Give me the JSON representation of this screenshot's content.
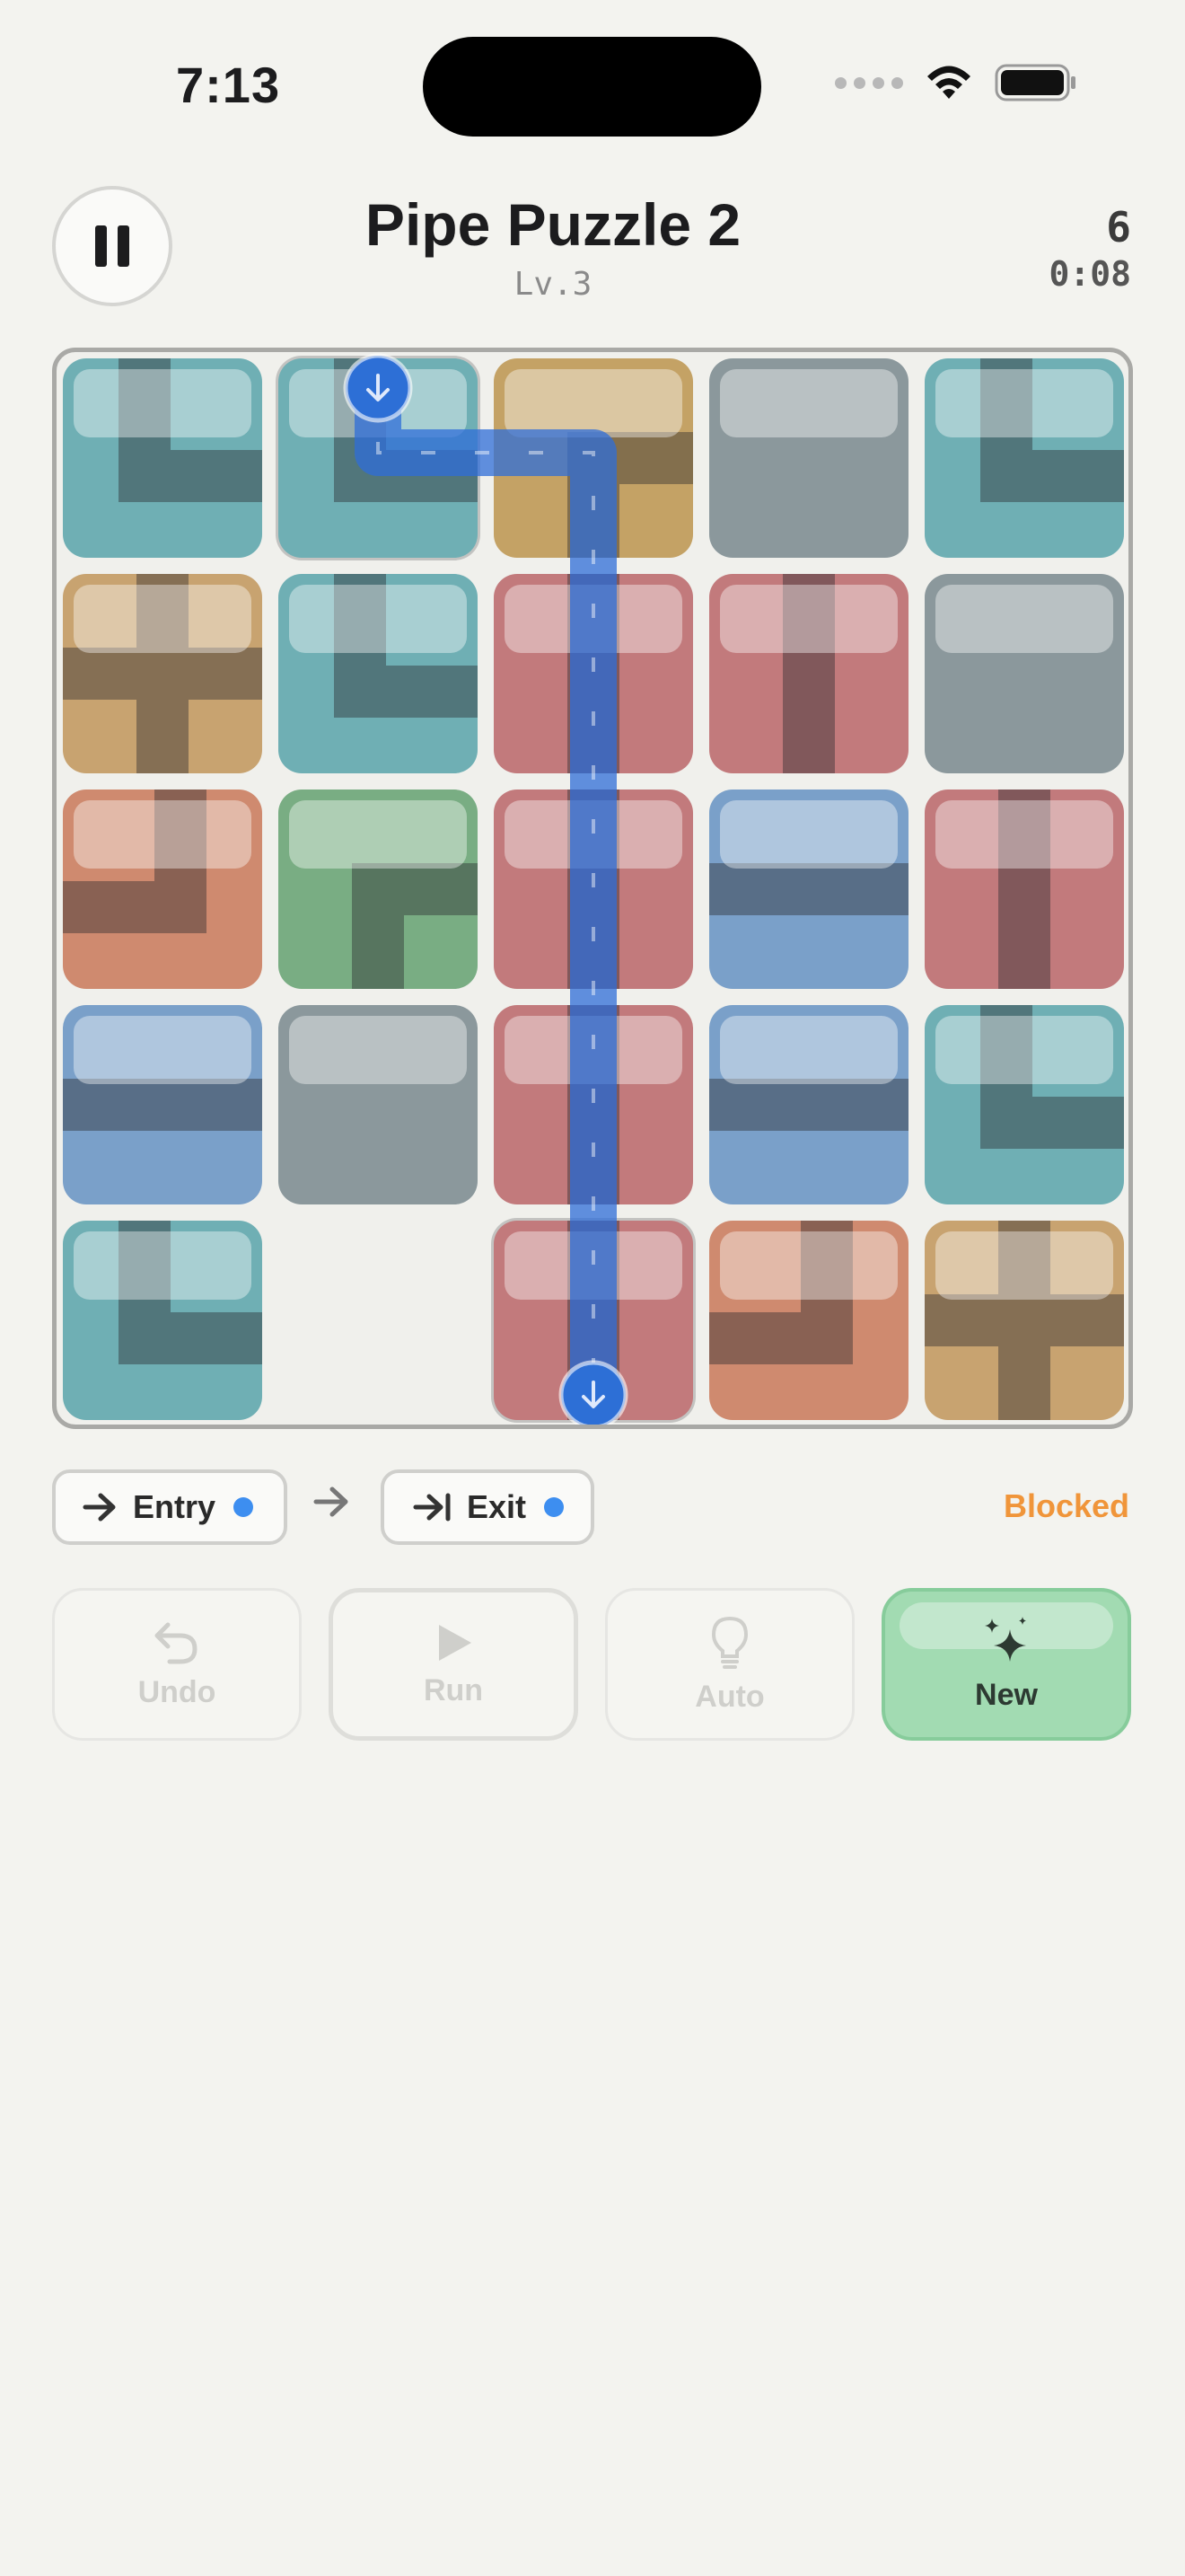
{
  "status_bar": {
    "time": "7:13",
    "wifi_icon": "wifi-icon",
    "battery_icon": "battery-icon"
  },
  "header": {
    "title": "Pipe Puzzle 2",
    "level": "Lv.3",
    "score": "6",
    "timer": "0:08",
    "pause_icon": "pause-icon"
  },
  "board": {
    "rows": 5,
    "cols": 5,
    "tiles": [
      {
        "row": 0,
        "col": 0,
        "color": "teal",
        "shape": "elbow-up-right"
      },
      {
        "row": 0,
        "col": 1,
        "color": "teal",
        "shape": "elbow-up-right",
        "selected": true
      },
      {
        "row": 0,
        "col": 2,
        "color": "gold",
        "shape": "elbow-down-right"
      },
      {
        "row": 0,
        "col": 3,
        "color": "gray",
        "shape": "blocked"
      },
      {
        "row": 0,
        "col": 4,
        "color": "teal",
        "shape": "elbow-up-right"
      },
      {
        "row": 1,
        "col": 0,
        "color": "tan",
        "shape": "cross"
      },
      {
        "row": 1,
        "col": 1,
        "color": "teal",
        "shape": "elbow-up-right"
      },
      {
        "row": 1,
        "col": 2,
        "color": "red",
        "shape": "vertical"
      },
      {
        "row": 1,
        "col": 3,
        "color": "red",
        "shape": "vertical"
      },
      {
        "row": 1,
        "col": 4,
        "color": "gray",
        "shape": "blocked"
      },
      {
        "row": 2,
        "col": 0,
        "color": "orange",
        "shape": "elbow-up-left"
      },
      {
        "row": 2,
        "col": 1,
        "color": "green",
        "shape": "elbow-down-right"
      },
      {
        "row": 2,
        "col": 2,
        "color": "red",
        "shape": "vertical"
      },
      {
        "row": 2,
        "col": 3,
        "color": "blue",
        "shape": "horizontal"
      },
      {
        "row": 2,
        "col": 4,
        "color": "red",
        "shape": "vertical"
      },
      {
        "row": 3,
        "col": 0,
        "color": "blue",
        "shape": "horizontal"
      },
      {
        "row": 3,
        "col": 1,
        "color": "gray",
        "shape": "blocked"
      },
      {
        "row": 3,
        "col": 2,
        "color": "red",
        "shape": "vertical"
      },
      {
        "row": 3,
        "col": 3,
        "color": "blue",
        "shape": "horizontal"
      },
      {
        "row": 3,
        "col": 4,
        "color": "teal",
        "shape": "elbow-up-right"
      },
      {
        "row": 4,
        "col": 0,
        "color": "teal",
        "shape": "elbow-up-right"
      },
      {
        "row": 4,
        "col": 1,
        "color": "none",
        "shape": "empty"
      },
      {
        "row": 4,
        "col": 2,
        "color": "red",
        "shape": "vertical",
        "selected": true
      },
      {
        "row": 4,
        "col": 3,
        "color": "orange",
        "shape": "elbow-up-left"
      },
      {
        "row": 4,
        "col": 4,
        "color": "tan",
        "shape": "cross"
      }
    ],
    "colors": {
      "teal": "#6fafb4",
      "gold": "#c4a265",
      "gray": "#8b989c",
      "tan": "#c8a370",
      "red": "#c27a7c",
      "orange": "#cf8a6f",
      "green": "#79ad83",
      "blue": "#7aa0c9"
    },
    "path_cells": [
      [
        0,
        1
      ],
      [
        0,
        2
      ],
      [
        1,
        2
      ],
      [
        2,
        2
      ],
      [
        3,
        2
      ],
      [
        4,
        2
      ]
    ],
    "path_color": "#2f6ed8",
    "entry_cell": [
      0,
      1
    ],
    "exit_cell": [
      4,
      2
    ]
  },
  "legend": {
    "entry_label": "Entry",
    "exit_label": "Exit",
    "status": "Blocked",
    "dot_color": "#3d8ef0"
  },
  "actions": {
    "undo": "Undo",
    "run": "Run",
    "auto": "Auto",
    "new": "New"
  }
}
